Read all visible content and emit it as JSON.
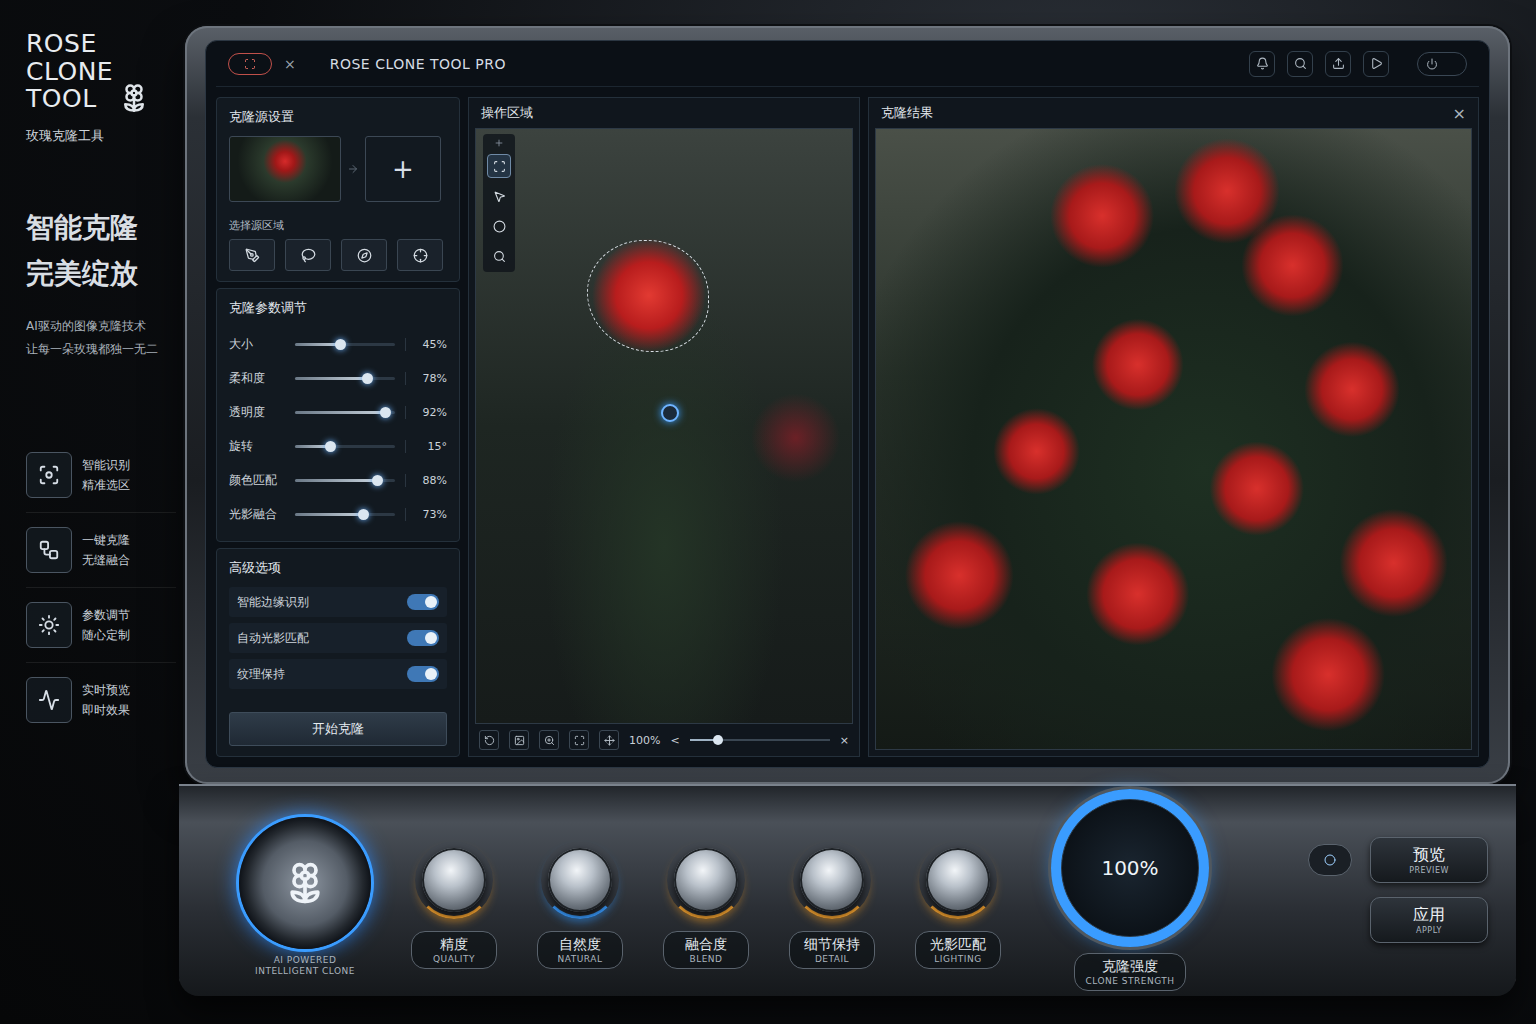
{
  "brand": {
    "title_lines": [
      "ROSE",
      "CLONE",
      "TOOL"
    ],
    "subtitle": "玫瑰克隆工具",
    "slogan": [
      "智能克隆",
      "完美绽放"
    ],
    "description": [
      "AI驱动的图像克隆技术",
      "让每一朵玫瑰都独一无二"
    ]
  },
  "features": [
    {
      "title": "智能识别",
      "subtitle": "精准选区"
    },
    {
      "title": "一键克隆",
      "subtitle": "无缝融合"
    },
    {
      "title": "参数调节",
      "subtitle": "随心定制"
    },
    {
      "title": "实时预览",
      "subtitle": "即时效果"
    }
  ],
  "window": {
    "title": "ROSE CLONE TOOL PRO",
    "close": "×"
  },
  "source": {
    "title": "克隆源设置",
    "add": "+",
    "region_label": "选择源区域",
    "tools": [
      {
        "selected": false
      },
      {
        "selected": false
      },
      {
        "selected": false
      },
      {
        "selected": false
      }
    ]
  },
  "params": {
    "title": "克隆参数调节",
    "sliders": [
      {
        "label": "大小",
        "value": "45%",
        "level": 0.45
      },
      {
        "label": "柔和度",
        "value": "78%",
        "level": 0.72
      },
      {
        "label": "透明度",
        "value": "92%",
        "level": 0.9
      },
      {
        "label": "旋转",
        "value": "15°",
        "level": 0.35
      },
      {
        "label": "颜色匹配",
        "value": "88%",
        "level": 0.82
      },
      {
        "label": "光影融合",
        "value": "73%",
        "level": 0.68
      }
    ]
  },
  "advanced": {
    "title": "高级选项",
    "options": [
      {
        "label": "智能边缘识别",
        "on": true
      },
      {
        "label": "自动光影匹配",
        "on": true
      },
      {
        "label": "纹理保持",
        "on": true
      }
    ]
  },
  "start_button": "开始克隆",
  "work": {
    "title": "操作区域",
    "tools": [
      {
        "selected": true
      },
      {
        "selected": false
      },
      {
        "selected": false
      },
      {
        "selected": false
      }
    ],
    "zoom": "100%",
    "prev": "<",
    "close": "×",
    "zoom_level": 0.2
  },
  "result": {
    "title": "克隆结果",
    "close": "×"
  },
  "console": {
    "main_label": [
      "AI POWERED",
      "INTELLIGENT CLONE"
    ],
    "knobs": [
      {
        "label": "精度",
        "sublabel": "QUALITY",
        "color": "#f0a030"
      },
      {
        "label": "自然度",
        "sublabel": "NATURAL",
        "color": "#3a9cff"
      },
      {
        "label": "融合度",
        "sublabel": "BLEND",
        "color": "#f0a030"
      },
      {
        "label": "细节保持",
        "sublabel": "DETAIL",
        "color": "#f0a030"
      },
      {
        "label": "光影匹配",
        "sublabel": "LIGHTING",
        "color": "#f0a030"
      }
    ],
    "dial": {
      "value": "100%",
      "level": 1,
      "label": "克隆强度",
      "sublabel": "CLONE STRENGTH"
    },
    "buttons": [
      {
        "label": "预览",
        "sublabel": "PREVIEW"
      },
      {
        "label": "应用",
        "sublabel": "APPLY"
      }
    ]
  }
}
